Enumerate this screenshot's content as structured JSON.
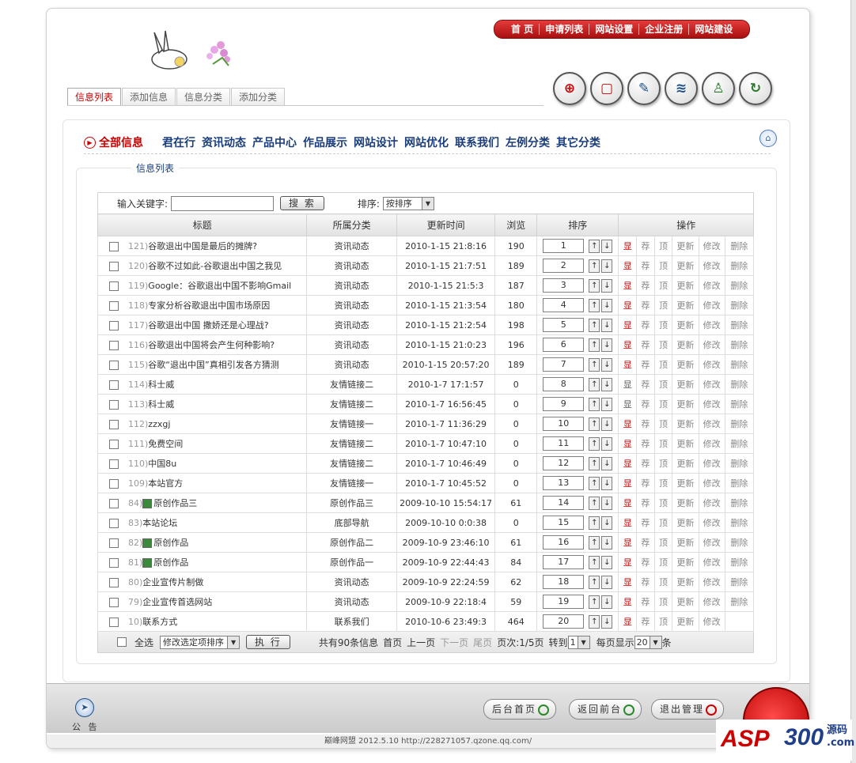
{
  "top_nav": [
    "首 页",
    "申请列表",
    "网站设置",
    "企业注册",
    "网站建设"
  ],
  "tabs": [
    {
      "label": "信息列表",
      "active": true
    },
    {
      "label": "添加信息",
      "active": false
    },
    {
      "label": "信息分类",
      "active": false
    },
    {
      "label": "添加分类",
      "active": false
    }
  ],
  "quick_icons": [
    "add-icon",
    "page-icon",
    "edit-icon",
    "document-icon",
    "user-icon",
    "refresh-icon"
  ],
  "categories": {
    "all": "全部信息",
    "items": [
      "君在行",
      "资讯动态",
      "产品中心",
      "作品展示",
      "网站设计",
      "网站优化",
      "联系我们",
      "左例分类",
      "其它分类"
    ]
  },
  "section_title": "信息列表",
  "search": {
    "label": "输入关键字:",
    "value": "",
    "button": "搜 索",
    "sort_label": "排序:",
    "sort_value": "按排序"
  },
  "table": {
    "headers": [
      "标题",
      "所属分类",
      "更新时间",
      "浏览",
      "排序",
      "操作"
    ],
    "actions": [
      "显",
      "荐",
      "顶",
      "更新",
      "修改",
      "删除"
    ],
    "rows": [
      {
        "num": "121)",
        "title": "谷歌退出中国是最后的摊牌?",
        "cat": "资讯动态",
        "time": "2010-1-15 21:8:16",
        "views": "190",
        "order": "1",
        "show": "red",
        "img": false,
        "delete": true
      },
      {
        "num": "120)",
        "title": "谷歌不过如此-谷歌退出中国之我见",
        "cat": "资讯动态",
        "time": "2010-1-15 21:7:51",
        "views": "189",
        "order": "2",
        "show": "red",
        "img": false,
        "delete": true
      },
      {
        "num": "119)",
        "title": "Google：谷歌退出中国不影响Gmail",
        "cat": "资讯动态",
        "time": "2010-1-15 21:5:3",
        "views": "187",
        "order": "3",
        "show": "red",
        "img": false,
        "delete": true
      },
      {
        "num": "118)",
        "title": "专家分析谷歌退出中国市场原因",
        "cat": "资讯动态",
        "time": "2010-1-15 21:3:54",
        "views": "180",
        "order": "4",
        "show": "red",
        "img": false,
        "delete": true
      },
      {
        "num": "117)",
        "title": "谷歌退出中国 撒娇还是心理战?",
        "cat": "资讯动态",
        "time": "2010-1-15 21:2:54",
        "views": "198",
        "order": "5",
        "show": "red",
        "img": false,
        "delete": true
      },
      {
        "num": "116)",
        "title": "谷歌退出中国将会产生何种影响?",
        "cat": "资讯动态",
        "time": "2010-1-15 21:0:23",
        "views": "196",
        "order": "6",
        "show": "red",
        "img": false,
        "delete": true
      },
      {
        "num": "115)",
        "title": "谷歌“退出中国”真相引发各方猜测",
        "cat": "资讯动态",
        "time": "2010-1-15 20:57:20",
        "views": "189",
        "order": "7",
        "show": "red",
        "img": false,
        "delete": true
      },
      {
        "num": "114)",
        "title": "科士威",
        "cat": "友情链接二",
        "time": "2010-1-7 17:1:57",
        "views": "0",
        "order": "8",
        "show": "gray",
        "img": false,
        "delete": true
      },
      {
        "num": "113)",
        "title": "科士威",
        "cat": "友情链接二",
        "time": "2010-1-7 16:56:45",
        "views": "0",
        "order": "9",
        "show": "gray",
        "img": false,
        "delete": true
      },
      {
        "num": "112)",
        "title": "zzxgj",
        "cat": "友情链接一",
        "time": "2010-1-7 11:36:29",
        "views": "0",
        "order": "10",
        "show": "red",
        "img": false,
        "delete": true
      },
      {
        "num": "111)",
        "title": "免费空间",
        "cat": "友情链接二",
        "time": "2010-1-7 10:47:10",
        "views": "0",
        "order": "11",
        "show": "red",
        "img": false,
        "delete": true
      },
      {
        "num": "110)",
        "title": "中国8u",
        "cat": "友情链接二",
        "time": "2010-1-7 10:46:49",
        "views": "0",
        "order": "12",
        "show": "red",
        "img": false,
        "delete": true
      },
      {
        "num": "109)",
        "title": "本站官方",
        "cat": "友情链接一",
        "time": "2010-1-7 10:45:52",
        "views": "0",
        "order": "13",
        "show": "red",
        "img": false,
        "delete": true
      },
      {
        "num": "84)",
        "title": "原创作品三",
        "cat": "原创作品三",
        "time": "2009-10-10 15:54:17",
        "views": "61",
        "order": "14",
        "show": "red",
        "img": true,
        "delete": true
      },
      {
        "num": "83)",
        "title": "本站论坛",
        "cat": "底部导航",
        "time": "2009-10-10 0:0:38",
        "views": "0",
        "order": "15",
        "show": "red",
        "img": false,
        "delete": true
      },
      {
        "num": "82)",
        "title": "原创作品",
        "cat": "原创作品二",
        "time": "2009-10-9 23:46:10",
        "views": "61",
        "order": "16",
        "show": "red",
        "img": true,
        "delete": true
      },
      {
        "num": "81)",
        "title": "原创作品",
        "cat": "原创作品一",
        "time": "2009-10-9 22:44:43",
        "views": "84",
        "order": "17",
        "show": "red",
        "img": true,
        "delete": true
      },
      {
        "num": "80)",
        "title": "企业宣传片制做",
        "cat": "资讯动态",
        "time": "2009-10-9 22:24:59",
        "views": "62",
        "order": "18",
        "show": "red",
        "img": false,
        "delete": true
      },
      {
        "num": "79)",
        "title": "企业宣传首选网站",
        "cat": "资讯动态",
        "time": "2009-10-9 22:18:4",
        "views": "59",
        "order": "19",
        "show": "red",
        "img": false,
        "delete": true
      },
      {
        "num": "10)",
        "title": "联系方式",
        "cat": "联系我们",
        "time": "2010-10-6 23:49:3",
        "views": "464",
        "order": "20",
        "show": "red",
        "img": false,
        "delete": false
      }
    ]
  },
  "footer_bar": {
    "select_all": "全选",
    "batch_select": "修改选定项排序",
    "execute": "执 行",
    "total": "共有90条信息",
    "first": "首页",
    "prev": "上一页",
    "next": "下一页",
    "last": "尾页",
    "page_info": "页次:1/5页",
    "goto_label": "转到",
    "goto_value": "1",
    "per_page_label": "每页显示",
    "per_page_value": "20",
    "per_page_unit": "条"
  },
  "bottom": {
    "notice": "公 告",
    "buttons": [
      "后台首页",
      "返回前台",
      "退出管理"
    ]
  },
  "copyright": "巅峰网盟 2012.5.10 http://228271057.qzone.qq.com/",
  "watermark": {
    "brand_a": "ASP",
    "brand_b": "300",
    "line1": "源码",
    "line2": ".com"
  }
}
